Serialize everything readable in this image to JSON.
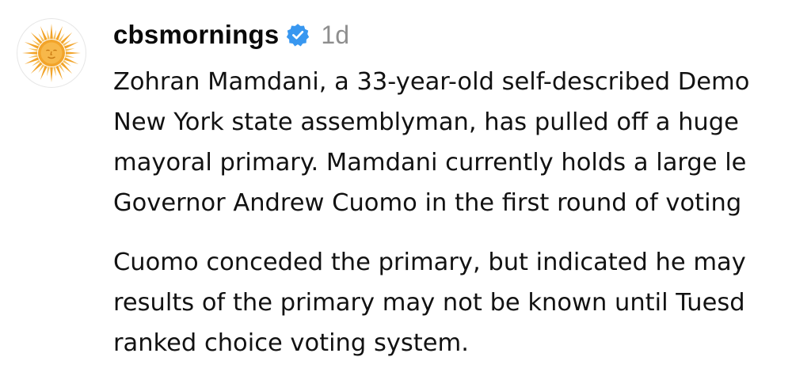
{
  "post": {
    "username": "cbsmornings",
    "verified_icon": "verified-badge-icon",
    "timestamp": "1d",
    "avatar_icon": "cbs-mornings-sun-logo",
    "colors": {
      "verified_blue": "#3897f0",
      "sun_gold": "#f2a42a",
      "timestamp_gray": "#8e8e8e"
    },
    "caption": {
      "paragraph1": [
        "Zohran Mamdani, a 33-year-old self-described Demo",
        "New York state assemblyman, has pulled off a huge",
        "mayoral primary. Mamdani currently holds a large le",
        "Governor Andrew Cuomo in the first round of voting"
      ],
      "paragraph2": [
        "Cuomo conceded the primary, but indicated he may",
        "results of the primary may not be known until Tuesd",
        "ranked choice voting system."
      ]
    }
  }
}
